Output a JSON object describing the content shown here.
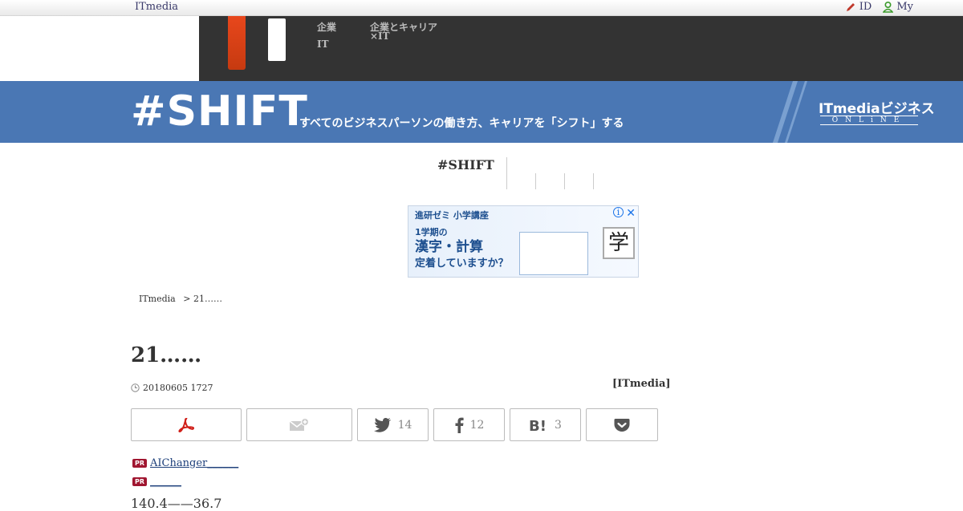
{
  "topbar": {
    "brand": "ITmedia",
    "id_label": "ID",
    "my_label": "My"
  },
  "header": {
    "nav_1_line1": "企業",
    "nav_1_line2": "IT",
    "nav_2_line1": "企業とキャリア",
    "nav_2_line2": "×IT"
  },
  "banner": {
    "logo": "#SHIFT",
    "tagline": "すべてのビジネスパーソンの働き方、キャリアを「シフト」する",
    "itmedia": "ITmediaビジネス",
    "online": "ONLiNE"
  },
  "subnav": {
    "title": "#SHIFT"
  },
  "ad": {
    "header": "進研ゼミ 小学講座",
    "line1": "1学期の",
    "line2": "漢字・計算",
    "line3": "定着していますか？",
    "kanji": "学",
    "close": "✕",
    "info": "i"
  },
  "breadcrumb": {
    "home": "ITmedia",
    "sep": ">",
    "current": "21……"
  },
  "article": {
    "title": "21……",
    "date": "20180605 1727",
    "author": "[ITmedia]"
  },
  "share": {
    "twitter_count": "14",
    "facebook_count": "12",
    "hatena_count": "3"
  },
  "pr": [
    {
      "badge": "PR",
      "text": "AIChanger______"
    },
    {
      "badge": "PR",
      "text": "______"
    }
  ],
  "body": {
    "first_line": "140.4——36.7"
  },
  "colors": {
    "banner": "#4a77b4",
    "dark_header": "#333333",
    "accent_orange": "#e8471c",
    "pr_badge": "#a01630"
  }
}
